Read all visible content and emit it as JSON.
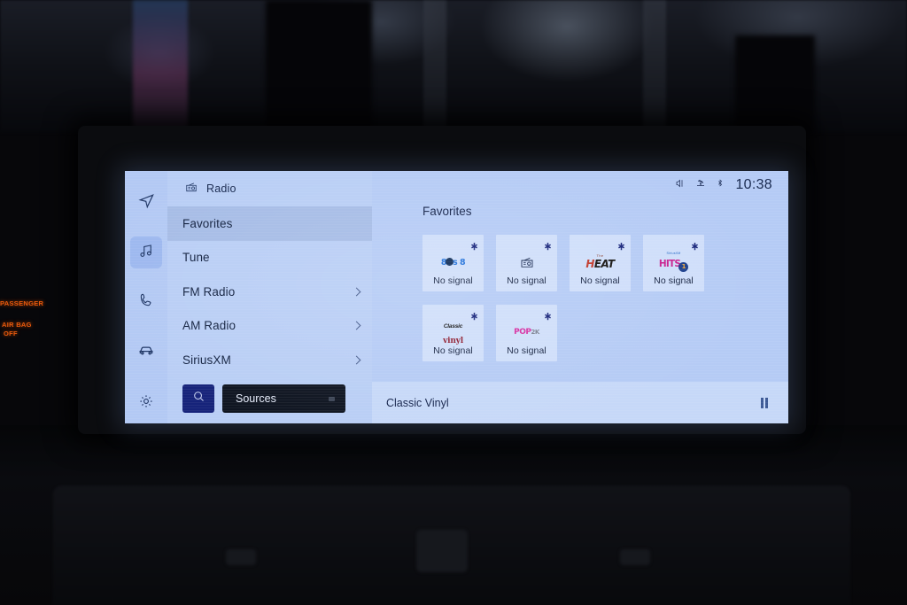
{
  "vehicle": {
    "airbag_indicator_line1": "PASSENGER",
    "airbag_indicator_line2": "AIR BAG",
    "airbag_indicator_line3": "OFF",
    "airbag_color": "#e8590c"
  },
  "statusbar": {
    "mute_icon": "mute-icon",
    "antenna_icon": "satellite-antenna-icon",
    "bluetooth_icon": "bluetooth-icon",
    "time": "10:38"
  },
  "panel": {
    "source_icon": "radio-icon",
    "title": "Radio",
    "menu": [
      {
        "label": "Favorites",
        "selected": true,
        "has_chevron": false
      },
      {
        "label": "Tune",
        "selected": false,
        "has_chevron": false
      },
      {
        "label": "FM Radio",
        "selected": false,
        "has_chevron": true
      },
      {
        "label": "AM Radio",
        "selected": false,
        "has_chevron": true
      },
      {
        "label": "SiriusXM",
        "selected": false,
        "has_chevron": true
      }
    ],
    "search_icon": "search-icon",
    "sources_label": "Sources"
  },
  "rail": {
    "items": [
      {
        "name": "navigation-icon",
        "active": false
      },
      {
        "name": "media-music-icon",
        "active": true
      },
      {
        "name": "phone-icon",
        "active": false
      },
      {
        "name": "vehicle-car-icon",
        "active": false
      },
      {
        "name": "settings-gear-icon",
        "active": false
      }
    ]
  },
  "favorites": {
    "heading": "Favorites",
    "tiles": [
      {
        "station": "80s on 8",
        "logo": "logo-80s-on-8",
        "status": "No signal",
        "pin_icon": "pin-add-icon"
      },
      {
        "station": "Radio preset",
        "logo": "logo-generic-radio",
        "status": "No signal",
        "pin_icon": "pin-add-icon"
      },
      {
        "station": "The Heat",
        "logo": "logo-the-heat",
        "status": "No signal",
        "pin_icon": "pin-add-icon"
      },
      {
        "station": "SiriusXM Hits 1",
        "logo": "logo-hits-1",
        "status": "No signal",
        "pin_icon": "pin-add-icon"
      },
      {
        "station": "Classic Vinyl",
        "logo": "logo-classic-vinyl",
        "status": "No signal",
        "pin_icon": "pin-add-icon"
      },
      {
        "station": "Pop 2K",
        "logo": "logo-pop-2k",
        "status": "No signal",
        "pin_icon": "pin-add-icon"
      }
    ]
  },
  "now_playing": {
    "track": "Classic Vinyl",
    "transport_icon": "pause-icon"
  },
  "colors": {
    "screen_bg": "#b5cbf5",
    "panel_bg": "#b9cef5",
    "rail_bg": "#b3c9f4",
    "selected_row": "#a6bce6",
    "tile_bg": "#cfdefa",
    "search_button": "#16237a",
    "sources_button": "#0e1420",
    "nowbar_bg": "#c6d8f8",
    "text_primary": "#14234a"
  }
}
